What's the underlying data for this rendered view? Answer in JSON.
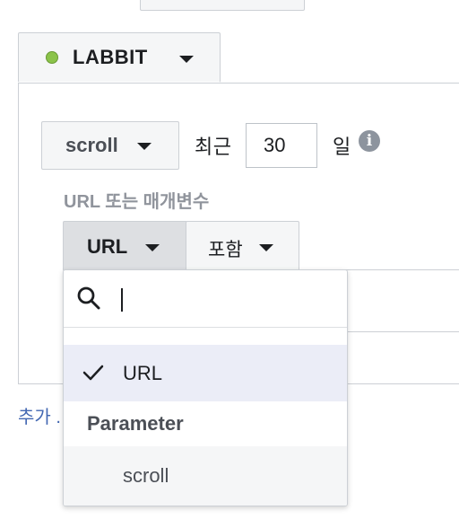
{
  "source_selector": {
    "name": "LABBIT",
    "status_color": "#8bc34a"
  },
  "rule": {
    "event_select": "scroll",
    "recent_prefix": "최근",
    "days_value": "30",
    "days_suffix": "일",
    "section_label": "URL 또는 매개변수",
    "field_select": "URL",
    "operator_select": "포함"
  },
  "dropdown": {
    "search_placeholder": "",
    "options": [
      {
        "label": "URL",
        "selected": true,
        "type": "option"
      },
      {
        "label": "Parameter",
        "type": "group-header"
      },
      {
        "label": "scroll",
        "type": "option"
      }
    ]
  },
  "footer": {
    "add_link": "추가 ."
  },
  "colors": {
    "link": "#4267b2",
    "selected_row": "#ebedf7",
    "border": "#ccd0d5"
  }
}
